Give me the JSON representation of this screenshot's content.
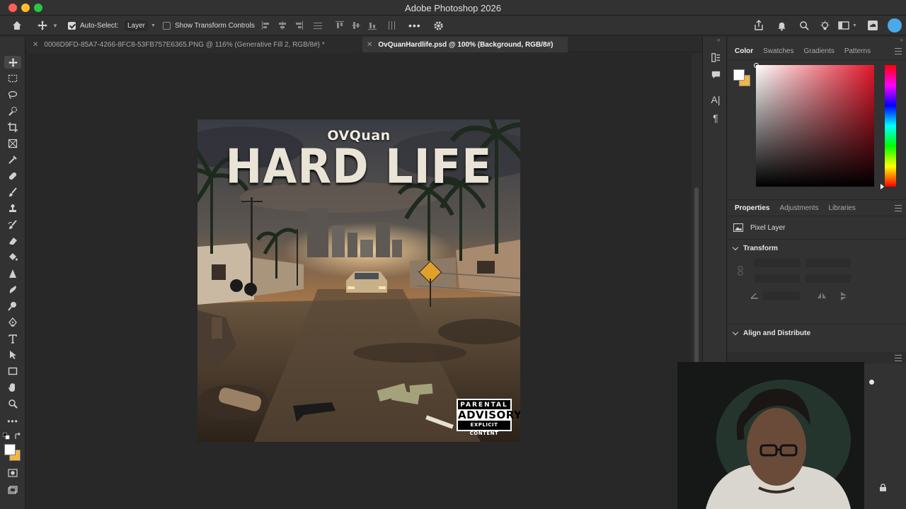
{
  "window": {
    "title": "Adobe Photoshop 2026"
  },
  "options_bar": {
    "auto_select_label": "Auto-Select:",
    "auto_select_value": "Layer",
    "show_transform_label": "Show Transform Controls"
  },
  "tabs": [
    {
      "label": "0006D9FD-85A7-4266-8FC8-53FB757E6365.PNG @ 116% (Generative Fill 2, RGB/8#) *"
    },
    {
      "label": "OvQuanHardlife.psd @ 100% (Background, RGB/8#)"
    }
  ],
  "color_panel": {
    "tabs": [
      "Color",
      "Swatches",
      "Gradients",
      "Patterns"
    ],
    "foreground": "#ffffff",
    "background": "#f0b64a"
  },
  "properties_panel": {
    "tabs": [
      "Properties",
      "Adjustments",
      "Libraries"
    ],
    "layer_type": "Pixel Layer",
    "transform_label": "Transform",
    "align_label": "Align and Distribute"
  },
  "artwork": {
    "artist": "OVQuan",
    "title": "HARD LIFE",
    "advisory_line1": "PARENTAL",
    "advisory_line2": "ADVISORY",
    "advisory_line3": "EXPLICIT CONTENT"
  }
}
